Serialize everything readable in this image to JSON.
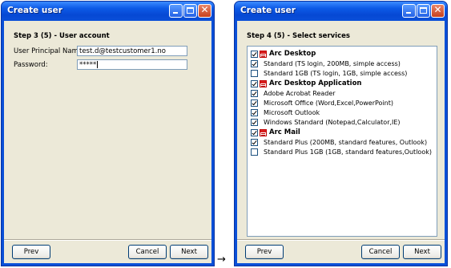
{
  "window1": {
    "title": "Create user",
    "step": "Step 3 (5) - User account",
    "fields": {
      "upn_label": "User Principal Name:",
      "upn_value": "test.d@testcustomer1.no",
      "password_label": "Password:",
      "password_value": "*****"
    },
    "buttons": {
      "prev": "Prev",
      "cancel": "Cancel",
      "next": "Next"
    }
  },
  "window2": {
    "title": "Create user",
    "step": "Step 4 (5) - Select services",
    "services": [
      {
        "label": "Arc Desktop",
        "kind": "category",
        "checked": true
      },
      {
        "label": "Standard  (TS login, 200MB, simple access)",
        "kind": "item",
        "checked": true
      },
      {
        "label": "Standard  1GB (TS login, 1GB, simple access)",
        "kind": "item",
        "checked": false
      },
      {
        "label": "Arc Desktop Application",
        "kind": "category",
        "checked": true
      },
      {
        "label": "Adobe Acrobat Reader",
        "kind": "item",
        "checked": true
      },
      {
        "label": "Microsoft Office  (Word,Excel,PowerPoint)",
        "kind": "item",
        "checked": true
      },
      {
        "label": "Microsoft Outlook",
        "kind": "item",
        "checked": true
      },
      {
        "label": "Windows Standard (Notepad,Calculator,IE)",
        "kind": "item",
        "checked": true
      },
      {
        "label": "Arc Mail",
        "kind": "category",
        "checked": true
      },
      {
        "label": "Standard Plus (200MB, standard features, Outlook)",
        "kind": "item",
        "checked": true
      },
      {
        "label": "Standard Plus 1GB (1GB, standard features,Outlook)",
        "kind": "item",
        "checked": false
      }
    ],
    "buttons": {
      "prev": "Prev",
      "cancel": "Cancel",
      "next": "Next"
    }
  },
  "connector": {
    "arrow": "→"
  },
  "colors": {
    "titlebar": "#0a50d8",
    "client": "#ece9d8",
    "close_button": "#c7411f"
  },
  "icons": [
    "minimize-icon",
    "maximize-icon",
    "close-icon",
    "checkbox-icon",
    "app-list-icon",
    "right-arrow-icon"
  ]
}
